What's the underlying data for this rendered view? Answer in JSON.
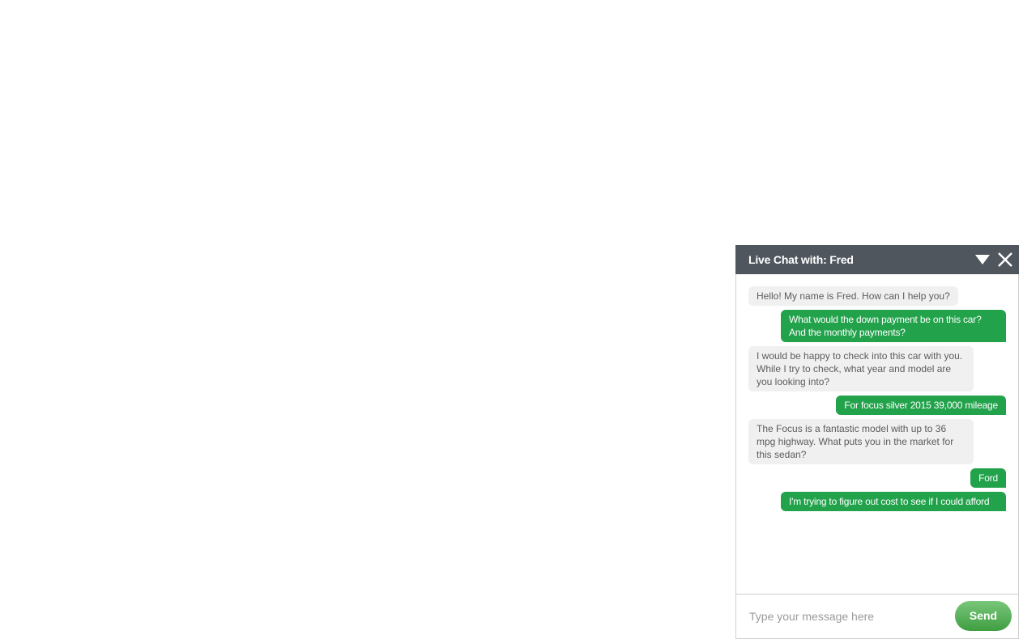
{
  "chat": {
    "title": "Live Chat with: Fred",
    "input_placeholder": "Type your message here",
    "send_label": "Send",
    "icons": {
      "minimize": "chevron-down-icon",
      "close": "close-icon"
    },
    "colors": {
      "header_bg": "#50565d",
      "user_bubble": "#22a24b",
      "agent_bubble": "#f0f0f0",
      "send_button": "#4caf50"
    },
    "messages": [
      {
        "sender": "agent",
        "lines": [
          "Hello! My name is Fred. How can I help you?"
        ]
      },
      {
        "sender": "user",
        "lines": [
          "What would the down payment be on this car?",
          "And the monthly payments?"
        ]
      },
      {
        "sender": "agent",
        "lines": [
          "I would be happy to check into this car with you.",
          "While I try to check, what year and model are",
          "you looking into?"
        ]
      },
      {
        "sender": "user",
        "lines": [
          "For focus silver 2015 39,000 mileage"
        ]
      },
      {
        "sender": "agent",
        "lines": [
          "The Focus is a fantastic model with up to 36",
          "mpg highway. What puts you in the market for",
          "this sedan?"
        ]
      },
      {
        "sender": "user",
        "lines": [
          "Ford"
        ]
      },
      {
        "sender": "user",
        "lines": [
          "I'm trying to figure out cost to see if I could afford"
        ]
      }
    ]
  }
}
